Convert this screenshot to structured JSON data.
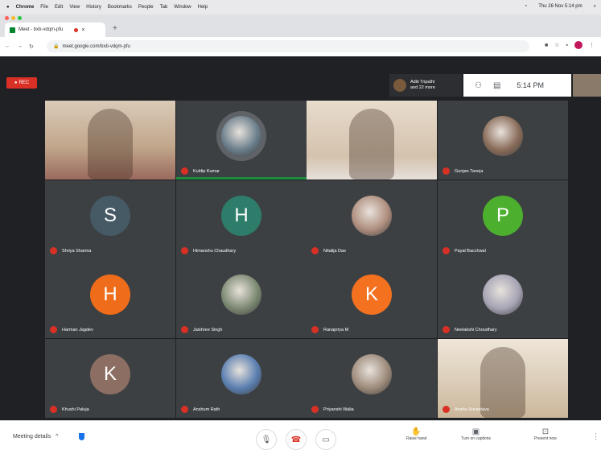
{
  "menubar": {
    "apple": "",
    "app": "Chrome",
    "items": [
      "File",
      "Edit",
      "View",
      "History",
      "Bookmarks",
      "People",
      "Tab",
      "Window",
      "Help"
    ],
    "status": "Thu 26 Nov 5:14 pm"
  },
  "tab": {
    "title": "Meet - bxb-vdqm-pfu",
    "close": "×",
    "new_tab": "+"
  },
  "address": {
    "url": "meet.google.com/bxb-vdqm-pfu"
  },
  "meet": {
    "rec_label": "REC",
    "presenter": {
      "name": "Aditi Tripathi",
      "sub": "and 22 more"
    },
    "time": "5:14 PM",
    "participants": [
      {
        "name": "",
        "kind": "video1"
      },
      {
        "name": "Kuldip Kumar",
        "kind": "photo",
        "color": "#6b7f8c",
        "speaking": true
      },
      {
        "name": "",
        "kind": "video3"
      },
      {
        "name": "Gunjan Taneja",
        "kind": "photo",
        "color": "#8a6d5a"
      },
      {
        "name": "Shriya Sharma",
        "kind": "letter",
        "letter": "S",
        "color": "#455a64"
      },
      {
        "name": "Himanshu Chaudhary",
        "kind": "letter",
        "letter": "H",
        "color": "#2e7d6b"
      },
      {
        "name": "Nitalija Das",
        "kind": "photo",
        "color": "#b08f7f"
      },
      {
        "name": "Payal Bacchwal",
        "kind": "letter",
        "letter": "P",
        "color": "#4caf2e"
      },
      {
        "name": "Harman Jagdev",
        "kind": "letter",
        "letter": "H",
        "color": "#ef6c1a"
      },
      {
        "name": "Jaishree Singh",
        "kind": "photo",
        "color": "#7d8a73"
      },
      {
        "name": "Ranapriya M",
        "kind": "letter",
        "letter": "K",
        "color": "#f4711f"
      },
      {
        "name": "Neelakshi Choudhary",
        "kind": "photo",
        "color": "#a7a4b5"
      },
      {
        "name": "Khushi Paluja",
        "kind": "letter",
        "letter": "K",
        "color": "#8d6e63"
      },
      {
        "name": "Anshum Rath",
        "kind": "photo",
        "color": "#5b7fb0"
      },
      {
        "name": "Priyanshi Walia",
        "kind": "photo",
        "color": "#9e8c7c"
      },
      {
        "name": "Anshu Srivastava",
        "kind": "video-last"
      }
    ]
  },
  "bottom": {
    "meeting_details": "Meeting details",
    "chevron": "^",
    "controls": {
      "mic": "🎙",
      "end": "☎",
      "cam": "▭"
    },
    "right": [
      {
        "icon": "✋",
        "label": "Raise hand"
      },
      {
        "icon": "▣",
        "label": "Turn on captions"
      },
      {
        "icon": "⊡",
        "label": "Present now"
      }
    ],
    "more": "⋮"
  },
  "colors": {
    "meet_bg": "#202124",
    "rec": "#d93025",
    "speaking": "#1e8e3e"
  }
}
